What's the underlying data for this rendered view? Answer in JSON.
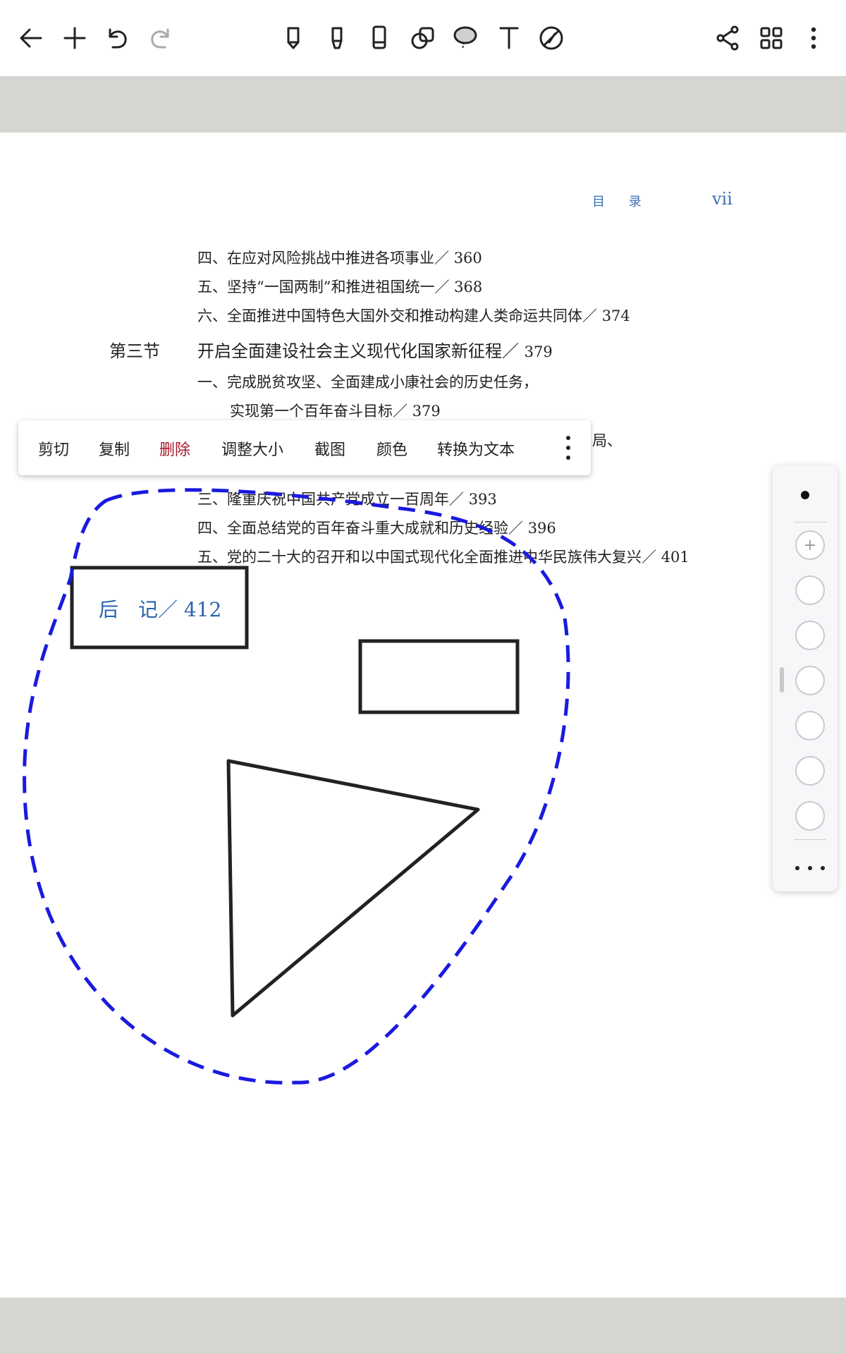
{
  "toolbar": {
    "left_icons": [
      "back-arrow-icon",
      "plus-icon",
      "undo-icon",
      "redo-icon"
    ],
    "center_icons": [
      "pen-icon",
      "highlighter-icon",
      "eraser-icon",
      "shapes-icon",
      "lasso-icon",
      "text-icon",
      "no-touch-icon"
    ],
    "right_icons": [
      "share-icon",
      "grid-icon",
      "more-vertical-icon"
    ]
  },
  "page": {
    "header_label": "目 录",
    "header_page": "vii",
    "toc": [
      {
        "text": "四、在应对风险挑战中推进各项事业",
        "page": "360"
      },
      {
        "text": "五、坚持“一国两制”和推进祖国统一",
        "page": "368"
      },
      {
        "text": "六、全面推进中国特色大国外交和推动构建人类命运共同体",
        "page": "374"
      },
      {
        "section": "第三节",
        "text": "开启全面建设社会主义现代化国家新征程",
        "page": "379"
      },
      {
        "text": "一、完成脱贫攻坚、全面建成小康社会的历史任务，",
        "page": ""
      },
      {
        "text": "实现第一个百年奋斗目标",
        "page": "379"
      },
      {
        "text": "局、",
        "page": ""
      },
      {
        "text": "三、隆重庆祝中国共产党成立一百周年",
        "page": "393"
      },
      {
        "text": "四、全面总结党的百年奋斗重大成就和历史经验",
        "page": "396"
      },
      {
        "text": "五、党的二十大的召开和以中国式现代化全面推进中华民族伟大复兴",
        "page": "401"
      }
    ],
    "houji": "后　记／ 412",
    "separator": "／"
  },
  "context_menu": {
    "items": [
      "剪切",
      "复制",
      "删除",
      "调整大小",
      "截图",
      "颜色",
      "转换为文本"
    ]
  },
  "palette": {
    "selected_color": "#111111",
    "swatch_border": "#c9c9cf"
  },
  "colors": {
    "lasso": "#1a1adf",
    "band": "#d5d6d1",
    "delete": "#a4182c",
    "header_blue": "#3d6fb5"
  }
}
